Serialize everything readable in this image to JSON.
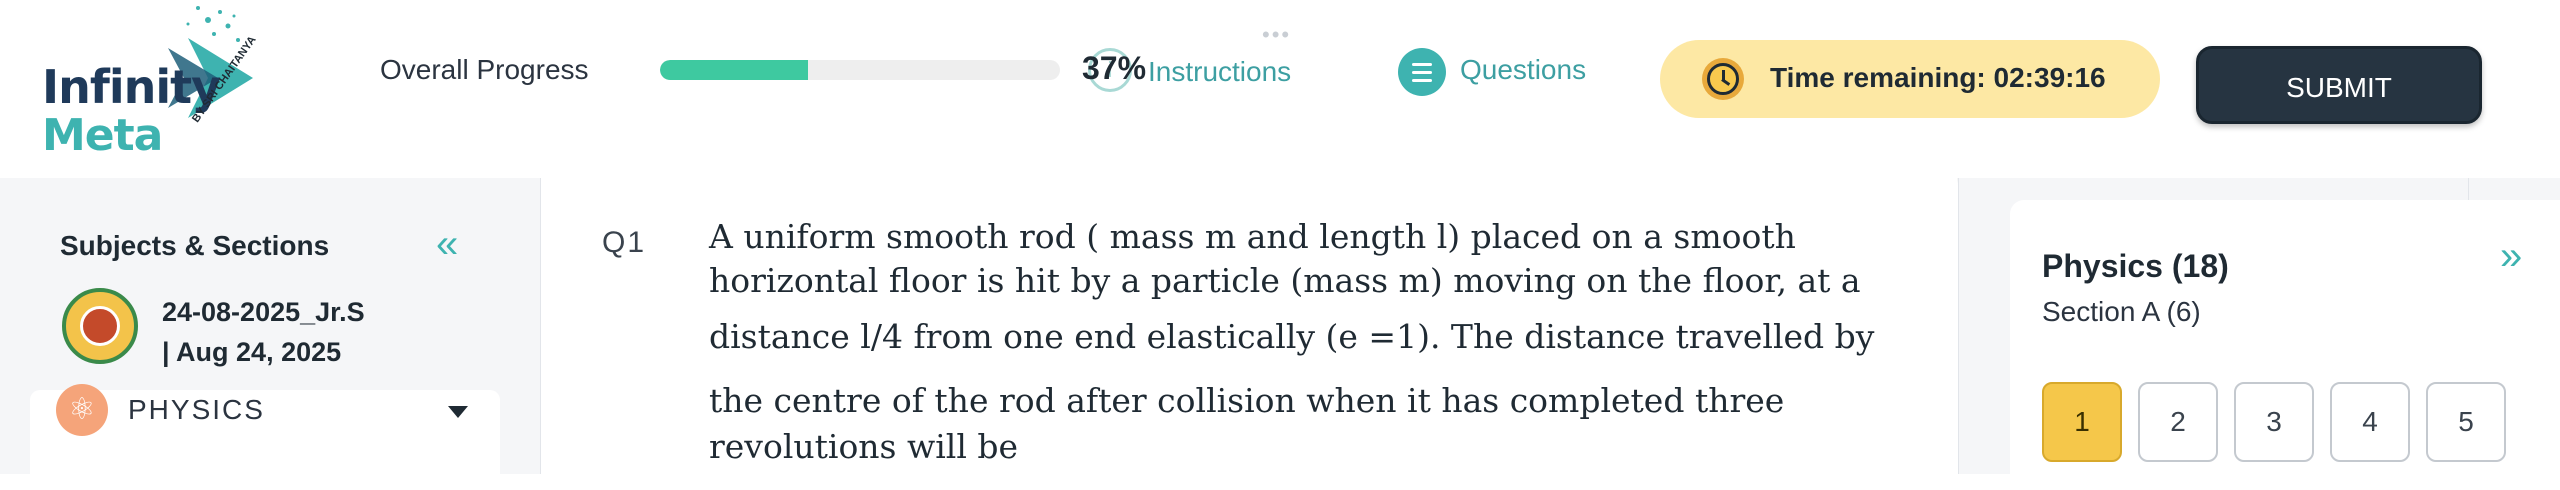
{
  "header": {
    "logo_line1": "Infinity",
    "logo_line2": "Meta",
    "logo_byline": "BY SRI CHAITANYA",
    "overall_progress_label": "Overall Progress",
    "progress_value": 37,
    "progress_percent_label": "37%",
    "instructions_label": "Instructions",
    "questions_label": "Questions",
    "timer_text": "Time remaining: 02:39:16",
    "submit_label": "SUBMIT",
    "drag_handle": "•••"
  },
  "left_panel": {
    "title": "Subjects & Sections",
    "collapse_glyph": "«",
    "test_name": "24-08-2025_Jr.S",
    "test_date": "| Aug 24, 2025",
    "subject": {
      "label": "PHYSICS",
      "icon": "atom-icon",
      "icon_glyph": "⚛"
    }
  },
  "question": {
    "number": "Q1",
    "lines": [
      "A uniform smooth rod ( mass m and length l) placed on a smooth",
      "horizontal floor is hit by a particle (mass m) moving on the floor, at a",
      "distance l/4 from one end elastically (e =1). The distance travelled by",
      "the centre of the rod after collision when it has completed three",
      "revolutions will be"
    ]
  },
  "right_panel": {
    "section_title": "Physics (18)",
    "section_subtitle": "Section A (6)",
    "expand_glyph": "»",
    "question_buttons": [
      "1",
      "2",
      "3",
      "4",
      "5"
    ],
    "active_index": 0
  },
  "colors": {
    "accent": "#3eb3b0",
    "progress_fill": "#3ec9a0",
    "timer_bg": "#fde8a4",
    "submit_bg": "#263441",
    "active_question": "#f5c74a"
  }
}
